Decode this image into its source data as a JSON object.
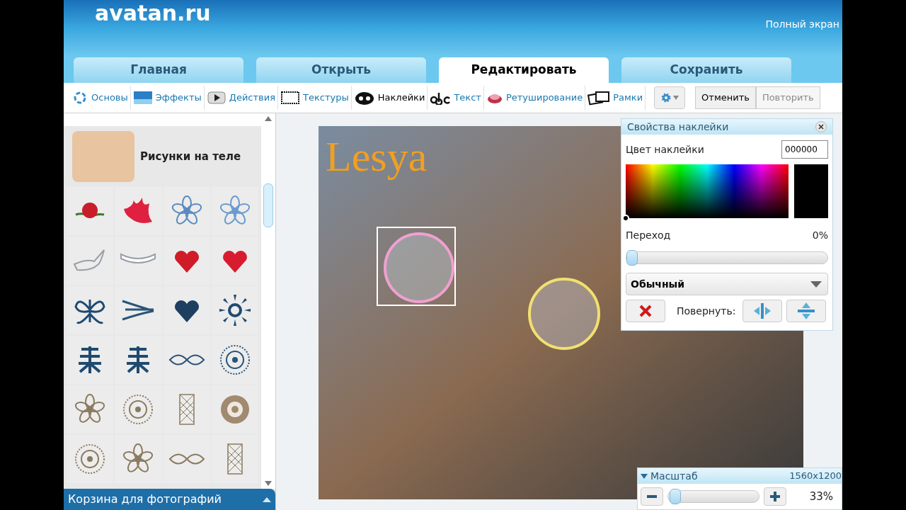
{
  "header": {
    "logo": "avatan.ru",
    "fullscreen": "Полный экран"
  },
  "tabs": [
    {
      "label": "Главная",
      "selected": false
    },
    {
      "label": "Открыть",
      "selected": false
    },
    {
      "label": "Редактировать",
      "selected": true
    },
    {
      "label": "Сохранить",
      "selected": false
    }
  ],
  "tools": [
    {
      "label": "Основы",
      "selected": false
    },
    {
      "label": "Эффекты",
      "selected": false
    },
    {
      "label": "Действия",
      "selected": false
    },
    {
      "label": "Текстуры",
      "selected": false
    },
    {
      "label": "Наклейки",
      "selected": true
    },
    {
      "label": "Текст",
      "selected": false
    },
    {
      "label": "Ретуширование",
      "selected": false
    },
    {
      "label": "Рамки",
      "selected": false
    }
  ],
  "history": [
    {
      "label": "Отменить",
      "disabled": false
    },
    {
      "label": "Повторить",
      "disabled": true
    }
  ],
  "sidebar": {
    "category": "Рисунки на теле",
    "footer": "Корзина для фотографий"
  },
  "canvas": {
    "text_layer": "Lesya"
  },
  "sticker_properties": {
    "title": "Свойства наклейки",
    "color_label": "Цвет наклейки",
    "color_value": "000000",
    "transition_label": "Переход",
    "transition_reading": "0%",
    "transition": {
      "level": 0
    },
    "blend_mode": "Обычный",
    "rotate_label": "Повернуть:"
  },
  "zoom": {
    "title": "Масштаб",
    "size": "1560x1200",
    "reading": "33%",
    "level": 0.02
  }
}
